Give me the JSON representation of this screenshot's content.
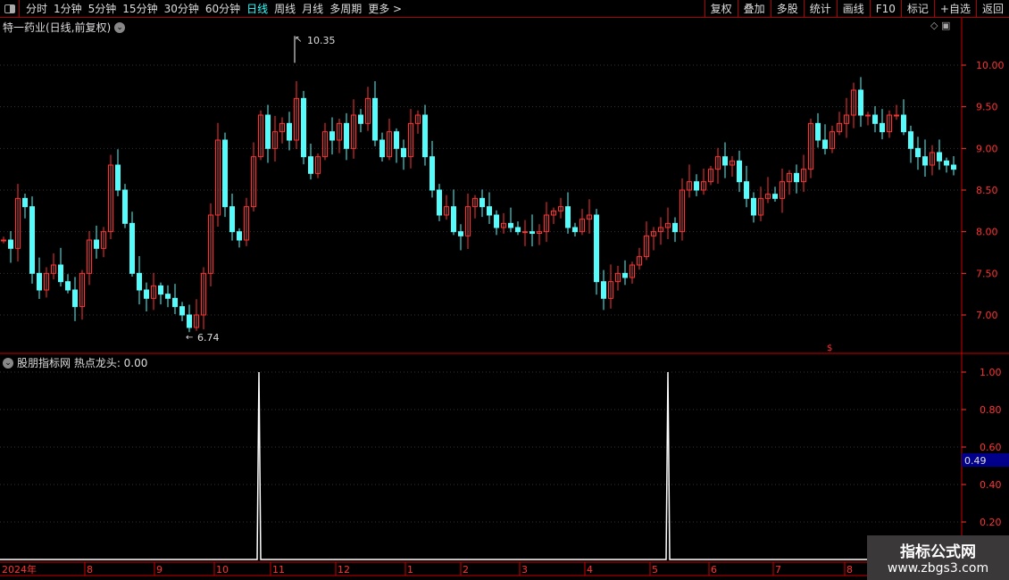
{
  "toolbar": {
    "periods": [
      "分时",
      "1分钟",
      "5分钟",
      "15分钟",
      "30分钟",
      "60分钟",
      "日线",
      "周线",
      "月线",
      "多周期",
      "更多 >"
    ],
    "active": "日线",
    "buttons": [
      "复权",
      "叠加",
      "多股",
      "统计",
      "画线",
      "F10",
      "标记",
      "+自选",
      "返回"
    ]
  },
  "main": {
    "title": "特一药业(日线,前复权)",
    "high_label": "10.35",
    "low_label": "6.74"
  },
  "indicator": {
    "title": "股朋指标网 热点龙头: 0.00",
    "current_value": "0.49"
  },
  "watermark": {
    "line1": "指标公式网",
    "line2": "www.zbgs3.com"
  },
  "colors": {
    "up": "#ff3232",
    "down": "#54fcfc",
    "grid": "#8b0000",
    "axis": "#ff3232"
  },
  "chart_data": [
    {
      "type": "candlestick",
      "title": "特一药业(日线,前复权)",
      "yticks": [
        "7.00",
        "7.50",
        "8.00",
        "8.50",
        "9.00",
        "9.50",
        "10.00"
      ],
      "ylim": [
        6.6,
        10.55
      ],
      "closes": [
        7.9,
        7.8,
        8.4,
        8.3,
        7.5,
        7.3,
        7.5,
        7.6,
        7.4,
        7.3,
        7.1,
        7.5,
        7.9,
        7.8,
        8.0,
        8.8,
        8.5,
        8.1,
        7.5,
        7.3,
        7.2,
        7.35,
        7.25,
        7.2,
        7.1,
        7.0,
        6.85,
        7.0,
        7.5,
        8.2,
        9.1,
        8.3,
        8.0,
        7.9,
        8.3,
        8.9,
        9.4,
        9.0,
        9.2,
        9.3,
        9.1,
        9.6,
        8.9,
        8.7,
        8.9,
        9.2,
        9.1,
        9.3,
        9.0,
        9.4,
        9.3,
        9.6,
        9.1,
        8.9,
        9.2,
        9.0,
        8.9,
        9.3,
        9.4,
        8.9,
        8.5,
        8.2,
        8.3,
        8.0,
        7.95,
        8.3,
        8.4,
        8.3,
        8.2,
        8.05,
        8.1,
        8.05,
        8.0,
        8.0,
        7.98,
        8.0,
        8.2,
        8.25,
        8.3,
        8.05,
        8.0,
        8.15,
        8.2,
        7.4,
        7.2,
        7.4,
        7.5,
        7.45,
        7.6,
        7.7,
        7.95,
        8.0,
        8.05,
        8.1,
        8.0,
        8.5,
        8.6,
        8.5,
        8.6,
        8.75,
        8.9,
        8.8,
        8.85,
        8.6,
        8.4,
        8.2,
        8.4,
        8.45,
        8.4,
        8.6,
        8.7,
        8.6,
        8.75,
        9.3,
        9.1,
        9.0,
        9.2,
        9.3,
        9.4,
        9.7,
        9.4,
        9.4,
        9.3,
        9.2,
        9.4,
        9.4,
        9.2,
        9.0,
        8.9,
        8.8,
        8.95,
        8.85,
        8.8,
        8.75
      ],
      "high": 10.35,
      "low": 6.74
    },
    {
      "type": "line",
      "title": "股朋指标网 热点龙头",
      "yticks": [
        "0.20",
        "0.40",
        "0.60",
        "0.80",
        "1.00"
      ],
      "ylim": [
        0,
        1.05
      ],
      "spikes": [
        {
          "month": "10",
          "value": 1.0
        },
        {
          "month": "5",
          "value": 1.0
        }
      ]
    }
  ],
  "xaxis": {
    "months": [
      "2024年",
      "8",
      "9",
      "10",
      "11",
      "12",
      "1",
      "2",
      "3",
      "4",
      "5",
      "6",
      "7",
      "8"
    ]
  }
}
